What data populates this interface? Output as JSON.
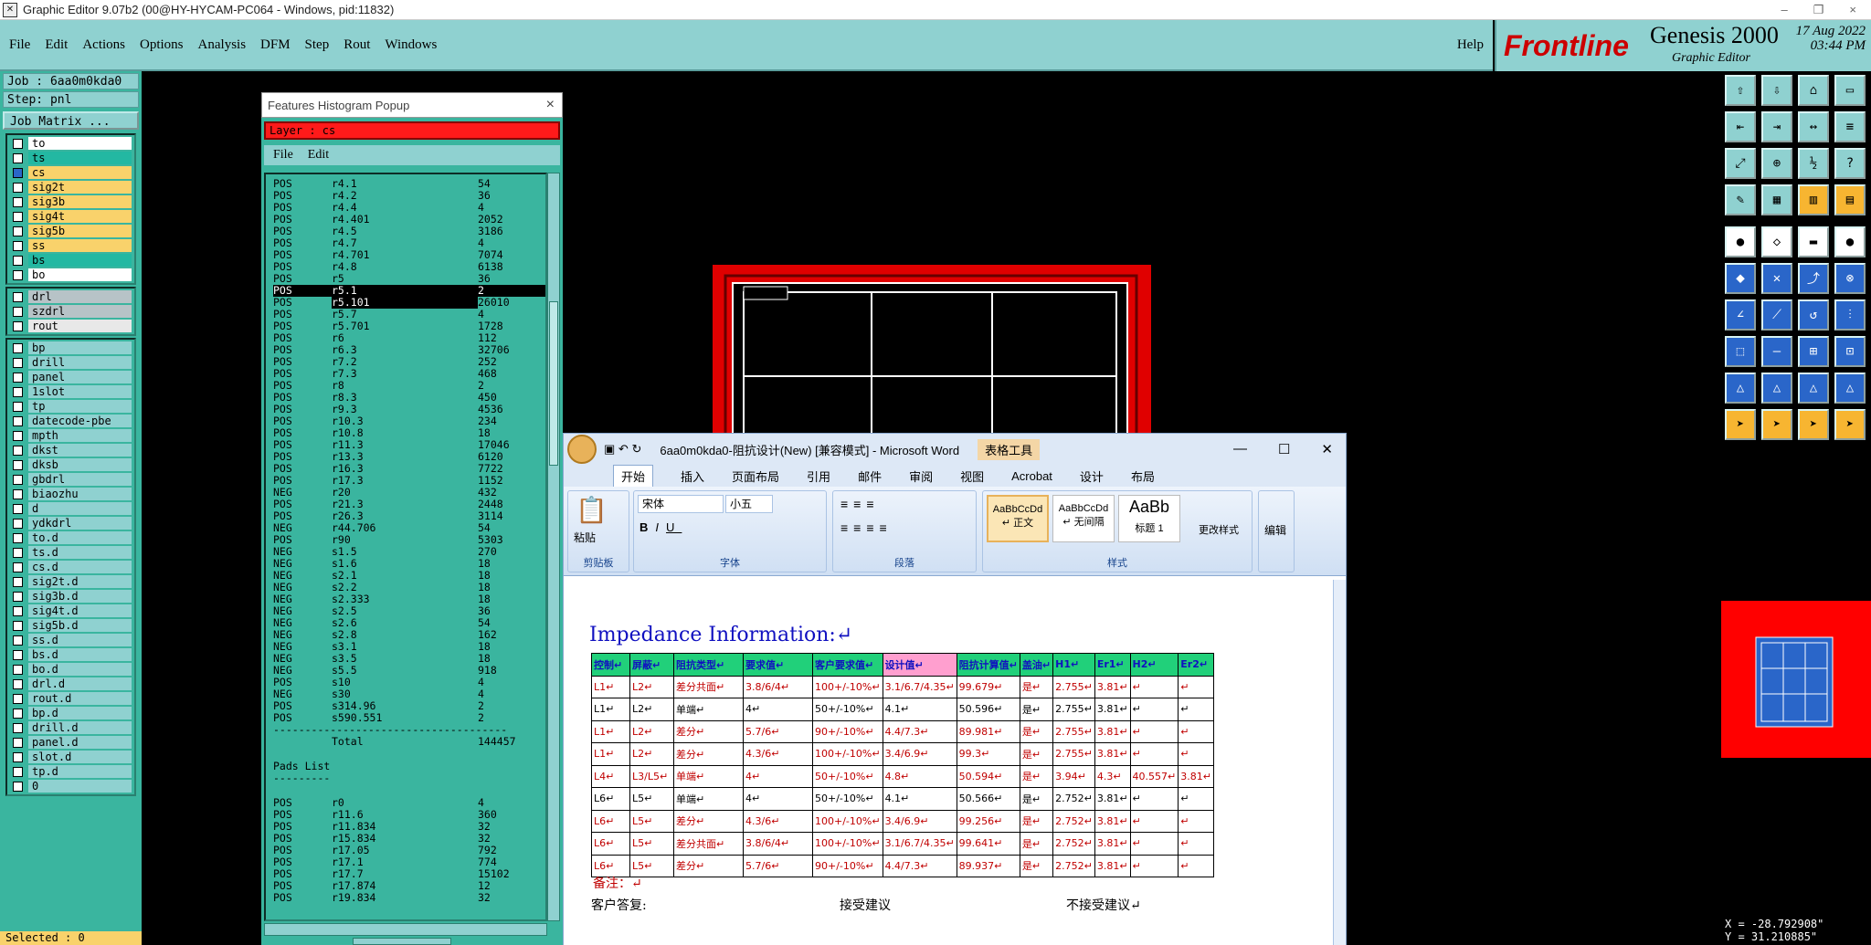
{
  "window": {
    "title": "Graphic Editor 9.07b2 (00@HY-HYCAM-PC064 - Windows, pid:11832)",
    "min": "–",
    "restore": "❐",
    "close": "×"
  },
  "menu": {
    "items": [
      "File",
      "Edit",
      "Actions",
      "Options",
      "Analysis",
      "DFM",
      "Step",
      "Rout",
      "Windows"
    ],
    "help": "Help"
  },
  "brand": {
    "logo": "Frontline",
    "product": "Genesis 2000",
    "sub": "Graphic Editor",
    "date": "17 Aug 2022",
    "time": "03:44 PM"
  },
  "left": {
    "job": "Job : 6aa0m0kda0",
    "step": "Step: pnl",
    "job_matrix": "Job Matrix ...",
    "selected": "Selected : 0",
    "groups": [
      [
        {
          "n": "to",
          "c": "#ffffff"
        },
        {
          "n": "ts",
          "c": "#23b8a2"
        },
        {
          "n": "cs",
          "c": "#f9d26b",
          "active": true
        },
        {
          "n": "sig2t",
          "c": "#f9d26b"
        },
        {
          "n": "sig3b",
          "c": "#f9d26b"
        },
        {
          "n": "sig4t",
          "c": "#f9d26b"
        },
        {
          "n": "sig5b",
          "c": "#f9d26b"
        },
        {
          "n": "ss",
          "c": "#f9d26b"
        },
        {
          "n": "bs",
          "c": "#23b8a2"
        },
        {
          "n": "bo",
          "c": "#ffffff"
        }
      ],
      [
        {
          "n": "drl",
          "c": "#b7c3c7"
        },
        {
          "n": "szdrl",
          "c": "#b7c3c7"
        },
        {
          "n": "rout",
          "c": "#e8e8e8"
        }
      ],
      [
        {
          "n": "bp",
          "c": "#8fd1d0"
        },
        {
          "n": "drill",
          "c": "#8fd1d0"
        },
        {
          "n": "panel",
          "c": "#8fd1d0"
        },
        {
          "n": "1slot",
          "c": "#8fd1d0"
        },
        {
          "n": "tp",
          "c": "#8fd1d0"
        },
        {
          "n": "datecode-pbe",
          "c": "#8fd1d0"
        },
        {
          "n": "mpth",
          "c": "#8fd1d0"
        },
        {
          "n": "dkst",
          "c": "#8fd1d0"
        },
        {
          "n": "dksb",
          "c": "#8fd1d0"
        },
        {
          "n": "gbdrl",
          "c": "#8fd1d0"
        },
        {
          "n": "biaozhu",
          "c": "#8fd1d0"
        },
        {
          "n": "d",
          "c": "#8fd1d0"
        },
        {
          "n": "ydkdrl",
          "c": "#8fd1d0"
        },
        {
          "n": "to.d",
          "c": "#8fd1d0"
        },
        {
          "n": "ts.d",
          "c": "#8fd1d0"
        },
        {
          "n": "cs.d",
          "c": "#8fd1d0"
        },
        {
          "n": "sig2t.d",
          "c": "#8fd1d0"
        },
        {
          "n": "sig3b.d",
          "c": "#8fd1d0"
        },
        {
          "n": "sig4t.d",
          "c": "#8fd1d0"
        },
        {
          "n": "sig5b.d",
          "c": "#8fd1d0"
        },
        {
          "n": "ss.d",
          "c": "#8fd1d0"
        },
        {
          "n": "bs.d",
          "c": "#8fd1d0"
        },
        {
          "n": "bo.d",
          "c": "#8fd1d0"
        },
        {
          "n": "drl.d",
          "c": "#8fd1d0"
        },
        {
          "n": "rout.d",
          "c": "#8fd1d0"
        },
        {
          "n": "bp.d",
          "c": "#8fd1d0"
        },
        {
          "n": "drill.d",
          "c": "#8fd1d0"
        },
        {
          "n": "panel.d",
          "c": "#8fd1d0"
        },
        {
          "n": "slot.d",
          "c": "#8fd1d0"
        },
        {
          "n": "tp.d",
          "c": "#8fd1d0"
        },
        {
          "n": "0",
          "c": "#8fd1d0"
        }
      ]
    ]
  },
  "histogram": {
    "title": "Features Histogram Popup",
    "close": "×",
    "layer": "Layer :  cs",
    "menu": [
      "File",
      "Edit"
    ],
    "rows": [
      [
        "POS",
        "r4.1",
        "54"
      ],
      [
        "POS",
        "r4.2",
        "36"
      ],
      [
        "POS",
        "r4.4",
        "4"
      ],
      [
        "POS",
        "r4.401",
        "2052"
      ],
      [
        "POS",
        "r4.5",
        "3186"
      ],
      [
        "POS",
        "r4.7",
        "4"
      ],
      [
        "POS",
        "r4.701",
        "7074"
      ],
      [
        "POS",
        "r4.8",
        "6138"
      ],
      [
        "POS",
        "r5",
        "36"
      ],
      [
        "POS",
        "r5.1",
        "2"
      ],
      [
        "POS",
        "r5.101",
        "26010"
      ],
      [
        "POS",
        "r5.7",
        "4"
      ],
      [
        "POS",
        "r5.701",
        "1728"
      ],
      [
        "POS",
        "r6",
        "112"
      ],
      [
        "POS",
        "r6.3",
        "32706"
      ],
      [
        "POS",
        "r7.2",
        "252"
      ],
      [
        "POS",
        "r7.3",
        "468"
      ],
      [
        "POS",
        "r8",
        "2"
      ],
      [
        "POS",
        "r8.3",
        "450"
      ],
      [
        "POS",
        "r9.3",
        "4536"
      ],
      [
        "POS",
        "r10.3",
        "234"
      ],
      [
        "POS",
        "r10.8",
        "18"
      ],
      [
        "POS",
        "r11.3",
        "17046"
      ],
      [
        "POS",
        "r13.3",
        "6120"
      ],
      [
        "POS",
        "r16.3",
        "7722"
      ],
      [
        "POS",
        "r17.3",
        "1152"
      ],
      [
        "NEG",
        "r20",
        "432"
      ],
      [
        "POS",
        "r21.3",
        "2448"
      ],
      [
        "POS",
        "r26.3",
        "3114"
      ],
      [
        "NEG",
        "r44.706",
        "54"
      ],
      [
        "POS",
        "r90",
        "5303"
      ],
      [
        "NEG",
        "s1.5",
        "270"
      ],
      [
        "NEG",
        "s1.6",
        "18"
      ],
      [
        "NEG",
        "s2.1",
        "18"
      ],
      [
        "NEG",
        "s2.2",
        "18"
      ],
      [
        "NEG",
        "s2.333",
        "18"
      ],
      [
        "NEG",
        "s2.5",
        "36"
      ],
      [
        "NEG",
        "s2.6",
        "54"
      ],
      [
        "NEG",
        "s2.8",
        "162"
      ],
      [
        "NEG",
        "s3.1",
        "18"
      ],
      [
        "NEG",
        "s3.5",
        "18"
      ],
      [
        "NEG",
        "s5.5",
        "918"
      ],
      [
        "POS",
        "s10",
        "4"
      ],
      [
        "NEG",
        "s30",
        "4"
      ],
      [
        "POS",
        "s314.96",
        "2"
      ],
      [
        "POS",
        "s590.551",
        "2"
      ]
    ],
    "sep": "-------------------------------------",
    "total_label": "Total",
    "total_value": "144457",
    "pads_title": "Pads List",
    "pads_sep": "---------",
    "pads": [
      [
        "POS",
        "r0",
        "4"
      ],
      [
        "POS",
        "r11.6",
        "360"
      ],
      [
        "POS",
        "r11.834",
        "32"
      ],
      [
        "POS",
        "r15.834",
        "32"
      ],
      [
        "POS",
        "r17.05",
        "792"
      ],
      [
        "POS",
        "r17.1",
        "774"
      ],
      [
        "POS",
        "r17.7",
        "15102"
      ],
      [
        "POS",
        "r17.874",
        "12"
      ],
      [
        "POS",
        "r19.834",
        "32"
      ]
    ]
  },
  "coords": {
    "x": "X = -28.792908\"",
    "y": "Y = 31.210885\""
  },
  "word": {
    "title": "6aa0m0kda0-阻抗设计(New) [兼容模式] - Microsoft Word",
    "table_tools": "表格工具",
    "tabs": [
      "开始",
      "插入",
      "页面布局",
      "引用",
      "邮件",
      "审阅",
      "视图",
      "Acrobat",
      "设计",
      "布局"
    ],
    "paste": "粘贴",
    "clipboard": "剪贴板",
    "font_name": "宋体",
    "font_size": "小五",
    "font_group": "字体",
    "para_group": "段落",
    "styles": [
      "AaBbCcDd",
      "AaBbCcDd",
      "AaBb"
    ],
    "style_names": [
      "↵ 正文",
      "↵ 无间隔",
      "标题 1"
    ],
    "style_group": "样式",
    "change_styles": "更改样式",
    "edit": "编辑",
    "heading": "Impedance Information:↵",
    "table": {
      "header": [
        "控制↵",
        "屏蔽↵",
        "阻抗类型↵",
        "要求值↵",
        "客户要求值↵",
        "设计值↵",
        "阻抗计算值↵",
        "盖油↵",
        "H1↵",
        "Er1↵",
        "H2↵",
        "Er2↵"
      ],
      "rows": [
        {
          "k": "r",
          "c": [
            "L1↵",
            "L2↵",
            "差分共面↵",
            "3.8/6/4↵",
            "100+/-10%↵",
            "3.1/6.7/4.35↵",
            "99.679↵",
            "是↵",
            "2.755↵",
            "3.81↵",
            "↵",
            "↵"
          ]
        },
        {
          "k": "b",
          "c": [
            "L1↵",
            "L2↵",
            "单端↵",
            "4↵",
            "50+/-10%↵",
            "4.1↵",
            "50.596↵",
            "是↵",
            "2.755↵",
            "3.81↵",
            "↵",
            "↵"
          ]
        },
        {
          "k": "r",
          "c": [
            "L1↵",
            "L2↵",
            "差分↵",
            "5.7/6↵",
            "90+/-10%↵",
            "4.4/7.3↵",
            "89.981↵",
            "是↵",
            "2.755↵",
            "3.81↵",
            "↵",
            "↵"
          ]
        },
        {
          "k": "r",
          "c": [
            "L1↵",
            "L2↵",
            "差分↵",
            "4.3/6↵",
            "100+/-10%↵",
            "3.4/6.9↵",
            "99.3↵",
            "是↵",
            "2.755↵",
            "3.81↵",
            "↵",
            "↵"
          ]
        },
        {
          "k": "r",
          "c": [
            "L4↵",
            "L3/L5↵",
            "单端↵",
            "4↵",
            "50+/-10%↵",
            "4.8↵",
            "50.594↵",
            "是↵",
            "3.94↵",
            "4.3↵",
            "40.557↵",
            "3.81↵"
          ]
        },
        {
          "k": "b",
          "c": [
            "L6↵",
            "L5↵",
            "单端↵",
            "4↵",
            "50+/-10%↵",
            "4.1↵",
            "50.566↵",
            "是↵",
            "2.752↵",
            "3.81↵",
            "↵",
            "↵"
          ]
        },
        {
          "k": "r",
          "c": [
            "L6↵",
            "L5↵",
            "差分↵",
            "4.3/6↵",
            "100+/-10%↵",
            "3.4/6.9↵",
            "99.256↵",
            "是↵",
            "2.752↵",
            "3.81↵",
            "↵",
            "↵"
          ]
        },
        {
          "k": "r",
          "c": [
            "L6↵",
            "L5↵",
            "差分共面↵",
            "3.8/6/4↵",
            "100+/-10%↵",
            "3.1/6.7/4.35↵",
            "99.641↵",
            "是↵",
            "2.752↵",
            "3.81↵",
            "↵",
            "↵"
          ]
        },
        {
          "k": "r",
          "c": [
            "L6↵",
            "L5↵",
            "差分↵",
            "5.7/6↵",
            "90+/-10%↵",
            "4.4/7.3↵",
            "89.937↵",
            "是↵",
            "2.752↵",
            "3.81↵",
            "↵",
            "↵"
          ]
        }
      ]
    },
    "note": "备注：↵",
    "reply": "客户答复:",
    "accept": "接受建议",
    "reject": "不接受建议↵"
  }
}
